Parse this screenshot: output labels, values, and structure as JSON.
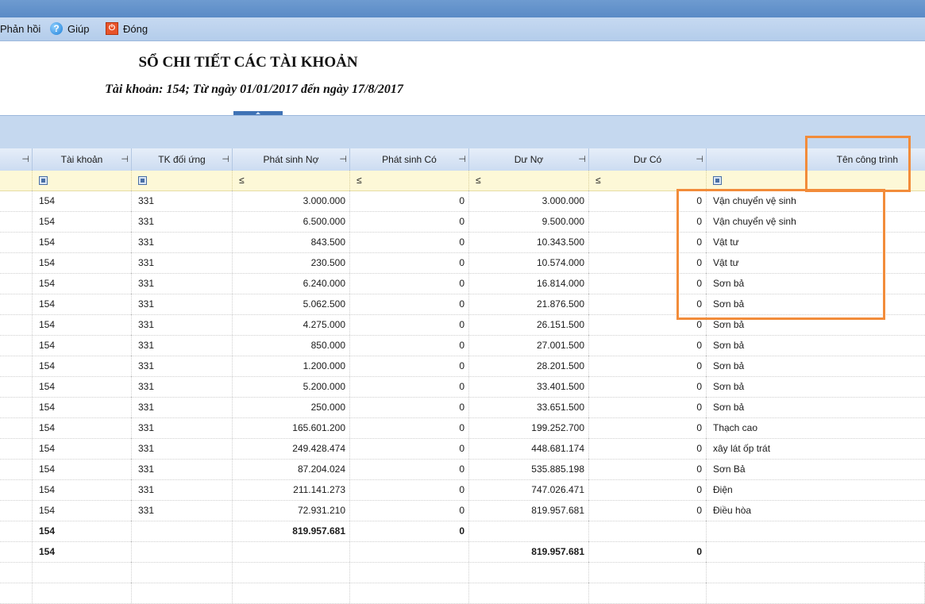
{
  "toolbar": {
    "feedback": "Phản hồi",
    "help": "Giúp",
    "close": "Đóng"
  },
  "report": {
    "title": "SỔ CHI TIẾT CÁC TÀI KHOẢN",
    "subtitle": "Tài khoản: 154; Từ ngày 01/01/2017 đến ngày 17/8/2017"
  },
  "columns": {
    "account": "Tài khoản",
    "counter": "TK đối ứng",
    "debit": "Phát sinh Nợ",
    "credit": "Phát sinh Có",
    "balance_debit": "Dư Nợ",
    "balance_credit": "Dư Có",
    "project": "Tên công trình"
  },
  "filter": {
    "le": "≤"
  },
  "rows": [
    {
      "account": "154",
      "counter": "331",
      "debit": "3.000.000",
      "credit": "0",
      "bal_debit": "3.000.000",
      "bal_credit": "0",
      "project": "Vận chuyển vệ sinh"
    },
    {
      "account": "154",
      "counter": "331",
      "debit": "6.500.000",
      "credit": "0",
      "bal_debit": "9.500.000",
      "bal_credit": "0",
      "project": "Vận chuyển vệ sinh"
    },
    {
      "account": "154",
      "counter": "331",
      "debit": "843.500",
      "credit": "0",
      "bal_debit": "10.343.500",
      "bal_credit": "0",
      "project": "Vật tư"
    },
    {
      "account": "154",
      "counter": "331",
      "debit": "230.500",
      "credit": "0",
      "bal_debit": "10.574.000",
      "bal_credit": "0",
      "project": "Vật tư"
    },
    {
      "account": "154",
      "counter": "331",
      "debit": "6.240.000",
      "credit": "0",
      "bal_debit": "16.814.000",
      "bal_credit": "0",
      "project": "Sơn bả"
    },
    {
      "account": "154",
      "counter": "331",
      "debit": "5.062.500",
      "credit": "0",
      "bal_debit": "21.876.500",
      "bal_credit": "0",
      "project": "Sơn bả"
    },
    {
      "account": "154",
      "counter": "331",
      "debit": "4.275.000",
      "credit": "0",
      "bal_debit": "26.151.500",
      "bal_credit": "0",
      "project": "Sơn bả"
    },
    {
      "account": "154",
      "counter": "331",
      "debit": "850.000",
      "credit": "0",
      "bal_debit": "27.001.500",
      "bal_credit": "0",
      "project": "Sơn bả"
    },
    {
      "account": "154",
      "counter": "331",
      "debit": "1.200.000",
      "credit": "0",
      "bal_debit": "28.201.500",
      "bal_credit": "0",
      "project": "Sơn bả"
    },
    {
      "account": "154",
      "counter": "331",
      "debit": "5.200.000",
      "credit": "0",
      "bal_debit": "33.401.500",
      "bal_credit": "0",
      "project": "Sơn bả"
    },
    {
      "account": "154",
      "counter": "331",
      "debit": "250.000",
      "credit": "0",
      "bal_debit": "33.651.500",
      "bal_credit": "0",
      "project": "Sơn bả"
    },
    {
      "account": "154",
      "counter": "331",
      "debit": "165.601.200",
      "credit": "0",
      "bal_debit": "199.252.700",
      "bal_credit": "0",
      "project": "Thạch cao"
    },
    {
      "account": "154",
      "counter": "331",
      "debit": "249.428.474",
      "credit": "0",
      "bal_debit": "448.681.174",
      "bal_credit": "0",
      "project": "xây lát ốp trát"
    },
    {
      "account": "154",
      "counter": "331",
      "debit": "87.204.024",
      "credit": "0",
      "bal_debit": "535.885.198",
      "bal_credit": "0",
      "project": "Sơn Bả"
    },
    {
      "account": "154",
      "counter": "331",
      "debit": "211.141.273",
      "credit": "0",
      "bal_debit": "747.026.471",
      "bal_credit": "0",
      "project": "Điện"
    },
    {
      "account": "154",
      "counter": "331",
      "debit": "72.931.210",
      "credit": "0",
      "bal_debit": "819.957.681",
      "bal_credit": "0",
      "project": "Điều hòa"
    }
  ],
  "totals": [
    {
      "account": "154",
      "counter": "",
      "debit": "819.957.681",
      "credit": "0",
      "bal_debit": "",
      "bal_credit": "",
      "project": ""
    },
    {
      "account": "154",
      "counter": "",
      "debit": "",
      "credit": "",
      "bal_debit": "819.957.681",
      "bal_credit": "0",
      "project": ""
    }
  ],
  "colors": {
    "highlight": "#f28c3a",
    "toolbar": "#c6d9f1",
    "filter_row": "#fdf8d7"
  }
}
